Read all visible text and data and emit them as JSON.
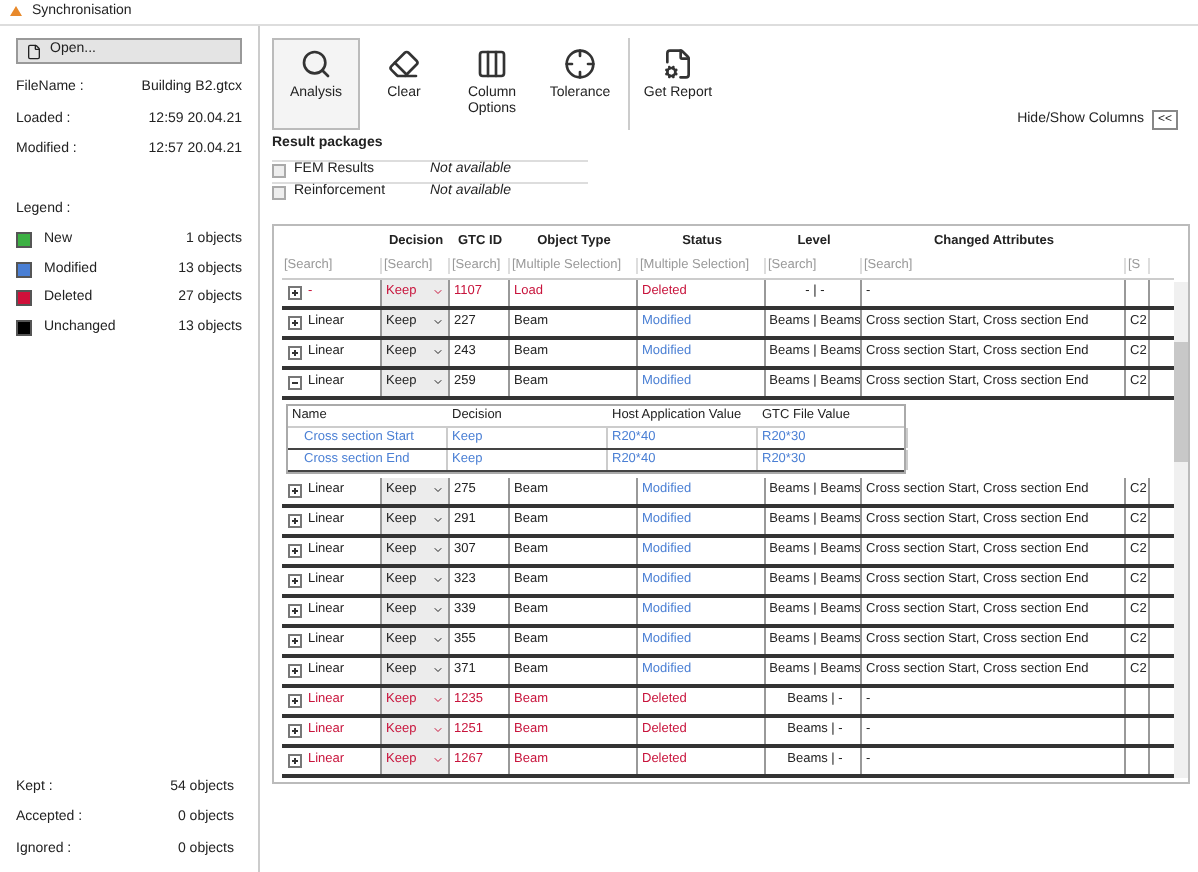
{
  "window": {
    "title": "Synchronisation"
  },
  "sidebar": {
    "open_button": "Open...",
    "file_info": [
      {
        "label": "FileName :",
        "value": "Building B2.gtcx"
      },
      {
        "label": "Loaded :",
        "value": "12:59 20.04.21"
      },
      {
        "label": "Modified :",
        "value": "12:57 20.04.21"
      }
    ],
    "legend_title": "Legend :",
    "legend": [
      {
        "label": "New",
        "count": "1 objects",
        "color": "#3cb043"
      },
      {
        "label": "Modified",
        "count": "13 objects",
        "color": "#4a7fd4"
      },
      {
        "label": "Deleted",
        "count": "27 objects",
        "color": "#d0103a"
      },
      {
        "label": "Unchanged",
        "count": "13 objects",
        "color": "#000000"
      }
    ],
    "totals": [
      {
        "label": "Kept :",
        "value": "54 objects"
      },
      {
        "label": "Accepted :",
        "value": "0 objects"
      },
      {
        "label": "Ignored :",
        "value": "0 objects"
      }
    ]
  },
  "toolbar": [
    {
      "label": "Analysis",
      "kind": "analysis",
      "selected": true
    },
    {
      "label": "Clear",
      "kind": "clear",
      "selected": false
    },
    {
      "label": "Column Options",
      "kind": "columns",
      "selected": false
    },
    {
      "label": "Tolerance",
      "kind": "tolerance",
      "selected": false
    },
    {
      "label": "Get Report",
      "kind": "report",
      "selected": false
    }
  ],
  "result_packages": {
    "title": "Result packages",
    "items": [
      {
        "label": "FEM Results",
        "checked": false,
        "status": "Not available"
      },
      {
        "label": "Reinforcement",
        "checked": false,
        "status": "Not available"
      }
    ]
  },
  "hide_show": {
    "label": "Hide/Show Columns",
    "button": "<<"
  },
  "table": {
    "columns": [
      {
        "search": "[Search]"
      },
      {
        "header": "Decision",
        "search": "[Search]"
      },
      {
        "header": "GTC ID",
        "search": "[Search]"
      },
      {
        "header": "Object Type",
        "search": "[Multiple Selection]"
      },
      {
        "header": "Status",
        "search": "[Multiple Selection]"
      },
      {
        "header": "Level",
        "search": "[Search]"
      },
      {
        "header": "Changed Attributes",
        "search": "[Search]"
      },
      {
        "search": "[S"
      }
    ],
    "rows": [
      {
        "kind": "deleted",
        "expanded": false,
        "name": "-",
        "decision": "Keep",
        "gtc_id": "1107",
        "object_type": "Load",
        "status": "Deleted",
        "level": "- | -",
        "changed_attributes": "-"
      },
      {
        "kind": "modified",
        "expanded": false,
        "name": "Linear",
        "decision": "Keep",
        "gtc_id": "227",
        "object_type": "Beam",
        "status": "Modified",
        "level": "Beams | Beams",
        "changed_attributes": "Cross section Start, Cross section End",
        "column_8": "C2"
      },
      {
        "kind": "modified",
        "expanded": false,
        "name": "Linear",
        "decision": "Keep",
        "gtc_id": "243",
        "object_type": "Beam",
        "status": "Modified",
        "level": "Beams | Beams",
        "changed_attributes": "Cross section Start, Cross section End",
        "column_8": "C2"
      },
      {
        "kind": "modified",
        "expanded": true,
        "name": "Linear",
        "decision": "Keep",
        "gtc_id": "259",
        "object_type": "Beam",
        "status": "Modified",
        "level": "Beams | Beams",
        "changed_attributes": "Cross section Start, Cross section End",
        "column_8": "C2",
        "details": {
          "columns": [
            "Name",
            "Decision",
            "Host Application Value",
            "GTC File Value"
          ],
          "rows": [
            [
              "Cross section Start",
              "Keep",
              "R20*40",
              "R20*30"
            ],
            [
              "Cross section End",
              "Keep",
              "R20*40",
              "R20*30"
            ]
          ]
        }
      },
      {
        "kind": "modified",
        "expanded": false,
        "name": "Linear",
        "decision": "Keep",
        "gtc_id": "275",
        "object_type": "Beam",
        "status": "Modified",
        "level": "Beams | Beams",
        "changed_attributes": "Cross section Start, Cross section End",
        "column_8": "C2"
      },
      {
        "kind": "modified",
        "expanded": false,
        "name": "Linear",
        "decision": "Keep",
        "gtc_id": "291",
        "object_type": "Beam",
        "status": "Modified",
        "level": "Beams | Beams",
        "changed_attributes": "Cross section Start, Cross section End",
        "column_8": "C2"
      },
      {
        "kind": "modified",
        "expanded": false,
        "name": "Linear",
        "decision": "Keep",
        "gtc_id": "307",
        "object_type": "Beam",
        "status": "Modified",
        "level": "Beams | Beams",
        "changed_attributes": "Cross section Start, Cross section End",
        "column_8": "C2"
      },
      {
        "kind": "modified",
        "expanded": false,
        "name": "Linear",
        "decision": "Keep",
        "gtc_id": "323",
        "object_type": "Beam",
        "status": "Modified",
        "level": "Beams | Beams",
        "changed_attributes": "Cross section Start, Cross section End",
        "column_8": "C2"
      },
      {
        "kind": "modified",
        "expanded": false,
        "name": "Linear",
        "decision": "Keep",
        "gtc_id": "339",
        "object_type": "Beam",
        "status": "Modified",
        "level": "Beams | Beams",
        "changed_attributes": "Cross section Start, Cross section End",
        "column_8": "C2"
      },
      {
        "kind": "modified",
        "expanded": false,
        "name": "Linear",
        "decision": "Keep",
        "gtc_id": "355",
        "object_type": "Beam",
        "status": "Modified",
        "level": "Beams | Beams",
        "changed_attributes": "Cross section Start, Cross section End",
        "column_8": "C2"
      },
      {
        "kind": "modified",
        "expanded": false,
        "name": "Linear",
        "decision": "Keep",
        "gtc_id": "371",
        "object_type": "Beam",
        "status": "Modified",
        "level": "Beams | Beams",
        "changed_attributes": "Cross section Start, Cross section End",
        "column_8": "C2"
      },
      {
        "kind": "deleted",
        "expanded": false,
        "name": "Linear",
        "decision": "Keep",
        "gtc_id": "1235",
        "object_type": "Beam",
        "status": "Deleted",
        "level": "Beams | -",
        "changed_attributes": "-"
      },
      {
        "kind": "deleted",
        "expanded": false,
        "name": "Linear",
        "decision": "Keep",
        "gtc_id": "1251",
        "object_type": "Beam",
        "status": "Deleted",
        "level": "Beams | -",
        "changed_attributes": "-"
      },
      {
        "kind": "deleted",
        "expanded": false,
        "name": "Linear",
        "decision": "Keep",
        "gtc_id": "1267",
        "object_type": "Beam",
        "status": "Deleted",
        "level": "Beams | -",
        "changed_attributes": "-"
      }
    ]
  }
}
